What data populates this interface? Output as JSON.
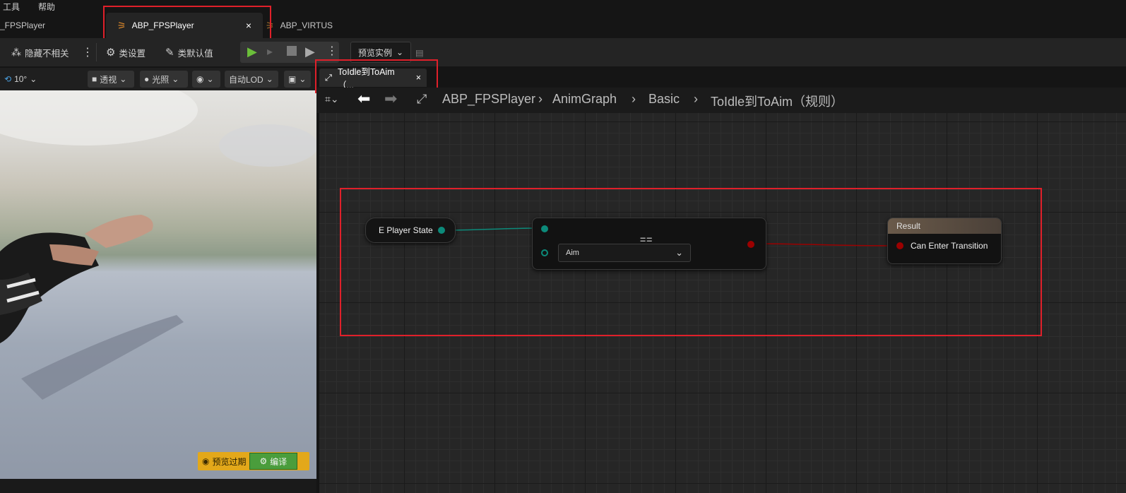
{
  "menu": {
    "tools": "工具",
    "help": "帮助"
  },
  "tabs": [
    {
      "label": "_FPSPlayer"
    },
    {
      "label": "ABP_FPSPlayer",
      "close": "×"
    },
    {
      "label": "ABP_VIRTUS"
    }
  ],
  "toolbar": {
    "hide_unrelated": "隐藏不相关",
    "class_settings": "类设置",
    "class_defaults": "类默认值",
    "preview_instance": "预览实例"
  },
  "viewport": {
    "fov": "10°",
    "perspective": "透视",
    "lighting": "光照",
    "lod": "自动LOD",
    "preview_expired": "预览过期",
    "compile": "编译"
  },
  "graph_tab": {
    "label": "ToIdle到ToAim（...",
    "close": "×"
  },
  "breadcrumb": [
    "ABP_FPSPlayer",
    "AnimGraph",
    "Basic",
    "ToIdle到ToAim（规则）"
  ],
  "nodes": {
    "player_state": "E Player State",
    "equals_symbol": "==",
    "enum_value": "Aim",
    "result_header": "Result",
    "result_pin": "Can Enter Transition"
  },
  "colors": {
    "accent_red": "#e0202a",
    "enum_pin": "#0c8a7a",
    "bool_pin": "#9b0000",
    "compile_green": "#4a9d3c",
    "warn_yellow": "#e3a81a"
  }
}
